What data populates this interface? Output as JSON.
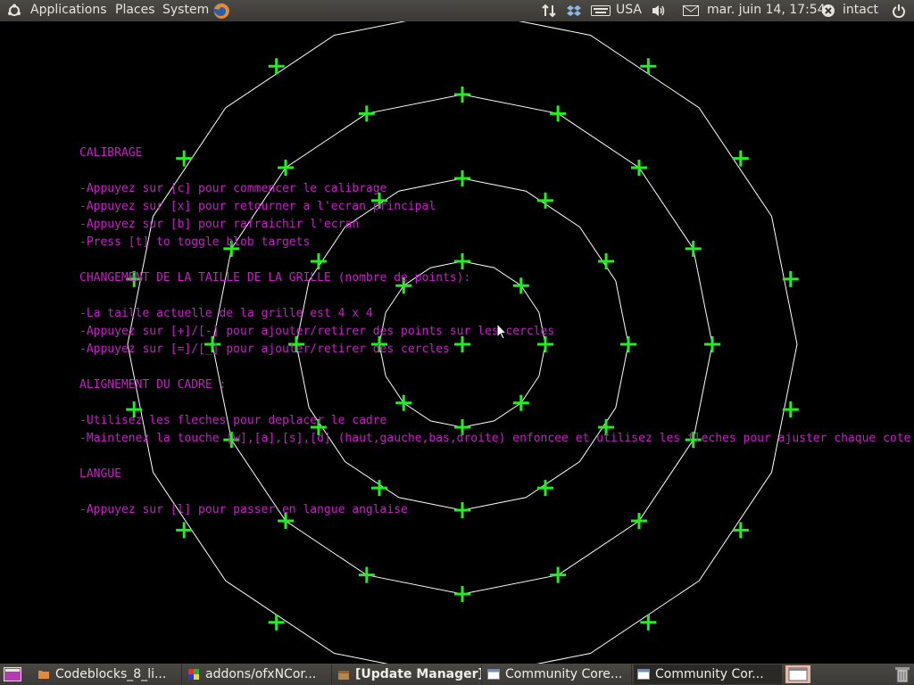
{
  "topbar": {
    "menus": [
      "Applications",
      "Places",
      "System"
    ],
    "keyboard_layout": "USA",
    "clock": "mar. juin 14, 17:54",
    "user": "intact"
  },
  "calibration_app": {
    "lines": [
      "CALIBRAGE",
      "",
      "-Appuyez sur [c] pour commencer le calibrage",
      "-Appuyez sur [x] pour retourner a l'ecran principal",
      "-Appuyez sur [b] pour rafraichir l'ecran",
      "-Press [t] to toggle blob targets",
      "",
      "CHANGEMENT DE LA TAILLE DE LA GRILLE (nombre de points):",
      "",
      "-La taille actuelle de la grille est 4 x 4",
      "-Appuyez sur [+]/[-] pour ajouter/retirer des points sur les cercles",
      "-Appuyez sur [=]/[_] pour ajouter/retirer des cercles",
      "",
      "ALIGNEMENT DU CADRE :",
      "",
      "-Utilisez les fleches pour deplacer le cadre",
      "-Maintenez la touche [w],[a],[s],[d] (haut,gauche,bas,droite) enfoncee et utilisez les fleches pour ajuster chaque cote",
      "",
      "LANGUE",
      "",
      "-Appuyez sur [l] pour passer en langue anglaise"
    ],
    "colors": {
      "text": "#c61fc6",
      "target": "#22ee22",
      "circle": "#ffffff"
    }
  },
  "taskbar": {
    "tasks": [
      {
        "label": "Codeblocks_8_li...",
        "icon": "folder-icon",
        "bold": false,
        "active": false
      },
      {
        "label": "addons/ofxNCor...",
        "icon": "app-grid-icon",
        "bold": false,
        "active": false
      },
      {
        "label": "[Update Manager]",
        "icon": "package-icon",
        "bold": true,
        "active": false
      },
      {
        "label": "Community Core...",
        "icon": "window-icon",
        "bold": false,
        "active": false
      },
      {
        "label": "Community Cor...",
        "icon": "window-icon",
        "bold": false,
        "active": true
      }
    ]
  }
}
